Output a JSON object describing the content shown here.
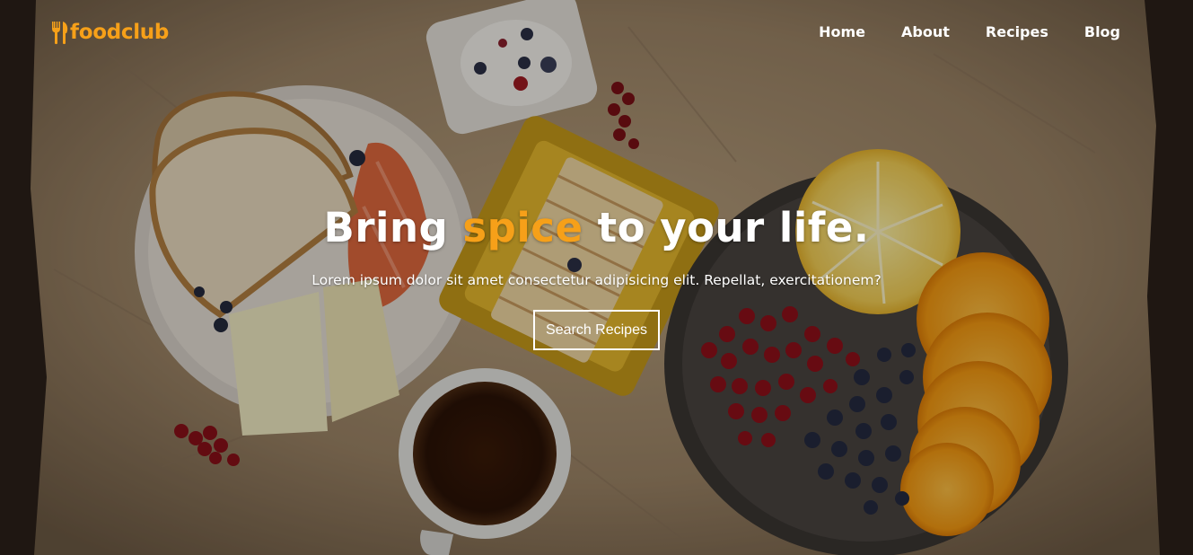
{
  "brand": {
    "name": "foodclub",
    "icon": "fork-knife-icon",
    "color": "#f6a019"
  },
  "nav": {
    "items": [
      {
        "label": "Home"
      },
      {
        "label": "About"
      },
      {
        "label": "Recipes"
      },
      {
        "label": "Blog"
      }
    ]
  },
  "hero": {
    "headline_before": "Bring",
    "headline_accent": "spice",
    "headline_after": "to your life.",
    "accent_color": "#f6a019",
    "subtitle": "Lorem ipsum dolor sit amet consectetur adipisicing elit. Repellat, exercitationem?",
    "button_label": "Search Recipes"
  }
}
